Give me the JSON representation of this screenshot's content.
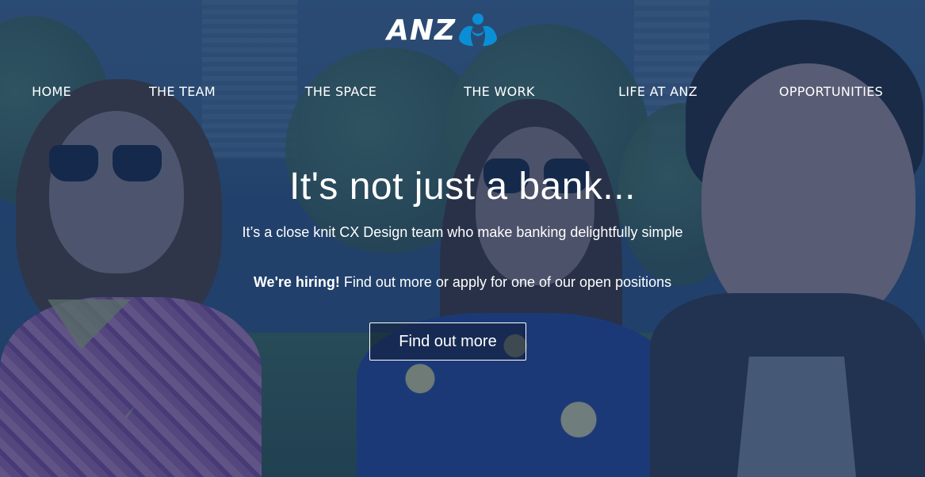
{
  "brand": {
    "logo_text": "ANZ",
    "logo_icon": "anz-people-icon",
    "accent_color": "#1a3666",
    "logo_icon_color": "#0a8fd6"
  },
  "nav": {
    "items": [
      {
        "label": "HOME"
      },
      {
        "label": "THE TEAM"
      },
      {
        "label": "THE SPACE"
      },
      {
        "label": "THE WORK"
      },
      {
        "label": "LIFE AT ANZ"
      },
      {
        "label": "OPPORTUNITIES"
      }
    ]
  },
  "hero": {
    "headline": "It's not just a bank...",
    "subheadline": "It’s a close knit CX Design team who make banking delightfully simple",
    "hiring_bold": "We're hiring!",
    "hiring_text": " Find out more or apply for one of our open positions",
    "cta_label": "Find out more"
  }
}
